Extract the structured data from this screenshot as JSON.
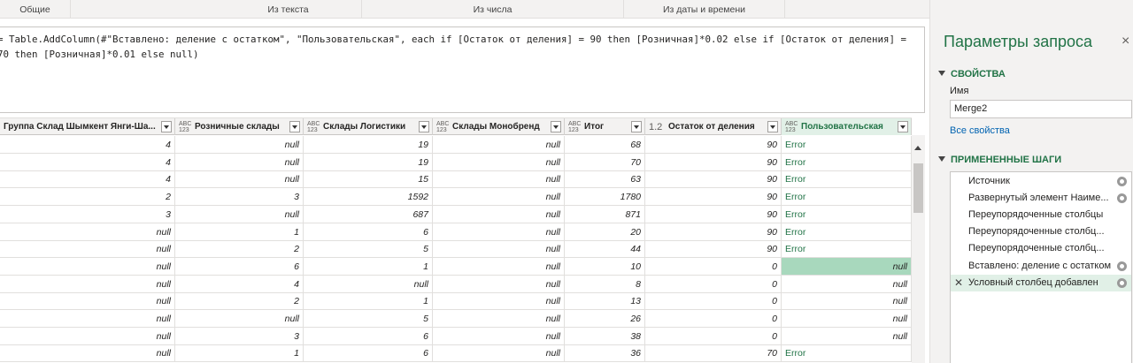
{
  "ribbon": {
    "groups": [
      "Общие",
      "Из текста",
      "Из числа",
      "Из даты и времени"
    ]
  },
  "formula": {
    "text": "= Table.AddColumn(#\"Вставлено: деление с остатком\", \"Пользовательская\", each if [Остаток от деления] = 90 then [Розничная]*0.02 else if [Остаток от деления] = 70 then [Розничная]*0.01 else null)"
  },
  "table": {
    "columns": [
      {
        "type": "",
        "label": "Группа Склад Шымкент Янги-Ша..."
      },
      {
        "type": "ABC\n123",
        "label": "Розничные склады"
      },
      {
        "type": "ABC\n123",
        "label": "Склады Логистики"
      },
      {
        "type": "ABC\n123",
        "label": "Склады Монобренд"
      },
      {
        "type": "ABC\n123",
        "label": "Итог"
      },
      {
        "type": "1.2",
        "label": "Остаток от деления"
      },
      {
        "type": "ABC\n123",
        "label": "Пользовательская"
      }
    ],
    "rows": [
      [
        "4",
        "null",
        "19",
        "null",
        "68",
        "90",
        "Error"
      ],
      [
        "4",
        "null",
        "19",
        "null",
        "70",
        "90",
        "Error"
      ],
      [
        "4",
        "null",
        "15",
        "null",
        "63",
        "90",
        "Error"
      ],
      [
        "2",
        "3",
        "1592",
        "null",
        "1780",
        "90",
        "Error"
      ],
      [
        "3",
        "null",
        "687",
        "null",
        "871",
        "90",
        "Error"
      ],
      [
        "null",
        "1",
        "6",
        "null",
        "20",
        "90",
        "Error"
      ],
      [
        "null",
        "2",
        "5",
        "null",
        "44",
        "90",
        "Error"
      ],
      [
        "null",
        "6",
        "1",
        "null",
        "10",
        "0",
        "null"
      ],
      [
        "null",
        "4",
        "null",
        "null",
        "8",
        "0",
        "null"
      ],
      [
        "null",
        "2",
        "1",
        "null",
        "13",
        "0",
        "null"
      ],
      [
        "null",
        "null",
        "5",
        "null",
        "26",
        "0",
        "null"
      ],
      [
        "null",
        "3",
        "6",
        "null",
        "38",
        "0",
        "null"
      ],
      [
        "null",
        "1",
        "6",
        "null",
        "36",
        "70",
        "Error"
      ]
    ]
  },
  "panel": {
    "title": "Параметры запроса",
    "close": "×",
    "properties_header": "СВОЙСТВА",
    "name_label": "Имя",
    "name_value": "Merge2",
    "all_properties_link": "Все свойства",
    "steps_header": "ПРИМЕНЕННЫЕ ШАГИ",
    "steps": [
      {
        "label": "Источник",
        "gear": true,
        "active": false
      },
      {
        "label": "Развернутый элемент Наиме...",
        "gear": true,
        "active": false
      },
      {
        "label": "Переупорядоченные столбцы",
        "gear": false,
        "active": false
      },
      {
        "label": "Переупорядоченные столбц...",
        "gear": false,
        "active": false
      },
      {
        "label": "Переупорядоченные столбц...",
        "gear": false,
        "active": false
      },
      {
        "label": "Вставлено: деление с остатком",
        "gear": true,
        "active": false
      },
      {
        "label": "Условный столбец добавлен",
        "gear": true,
        "active": true
      }
    ]
  },
  "colors": {
    "accent": "#217346",
    "highlight": "#a8d8bd",
    "link": "#0063b1"
  }
}
